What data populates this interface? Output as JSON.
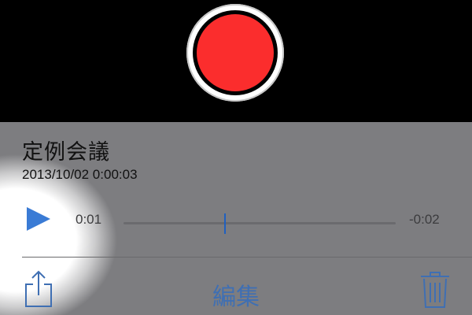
{
  "recording": {
    "title": "定例会議",
    "datetime": "2013/10/02  0:00:03"
  },
  "player": {
    "elapsed": "0:01",
    "remaining": "-0:02",
    "progress_fraction": 0.37
  },
  "toolbar": {
    "edit_label": "編集"
  },
  "icons": {
    "record": "record-icon",
    "play": "play-icon",
    "share": "share-icon",
    "delete": "trash-icon"
  },
  "colors": {
    "record_red": "#fb2d2d",
    "accent_blue": "#3f6fb3",
    "panel_gray": "#7d7d80"
  }
}
